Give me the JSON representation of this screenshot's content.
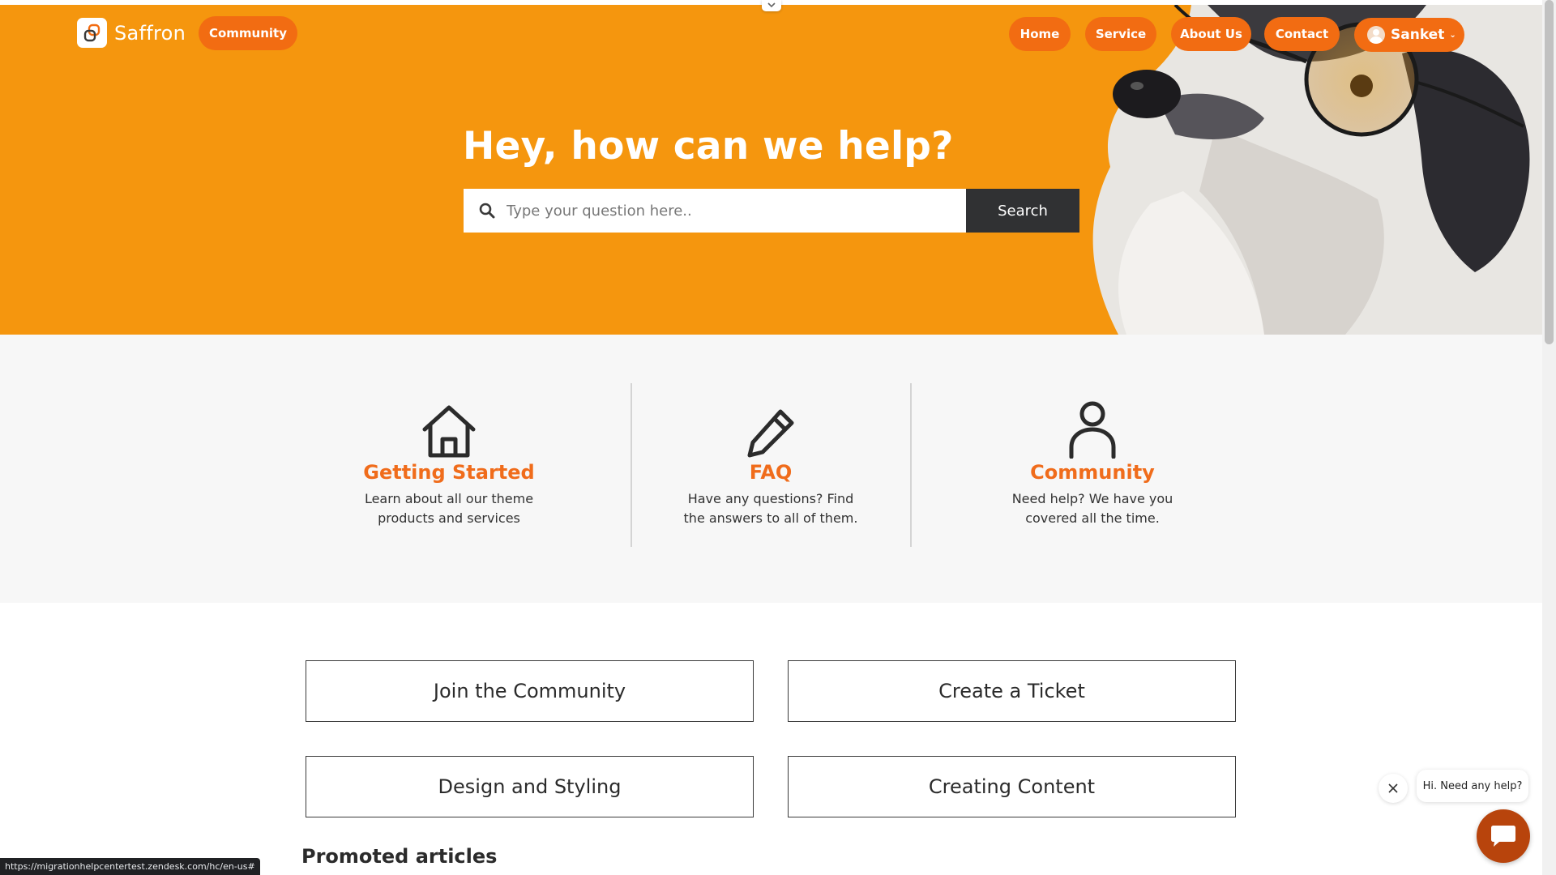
{
  "brand": {
    "name": "Saffron",
    "community_label": "Community"
  },
  "nav": {
    "items": [
      "Home",
      "Service",
      "About Us",
      "Contact"
    ],
    "user_name": "Sanket"
  },
  "hero": {
    "title": "Hey, how can we help?",
    "search_placeholder": "Type your question here..",
    "search_button": "Search"
  },
  "features": [
    {
      "icon": "house-icon",
      "title": "Getting Started",
      "line1": "Learn about all our theme",
      "line2": "products and services"
    },
    {
      "icon": "pencil-icon",
      "title": "FAQ",
      "line1": "Have any questions? Find",
      "line2": "the answers to all of them."
    },
    {
      "icon": "person-icon",
      "title": "Community",
      "line1": "Need help? We have you",
      "line2": "covered all the time."
    }
  ],
  "tiles": [
    "Join the Community",
    "Create a Ticket",
    "Design and Styling",
    "Creating Content"
  ],
  "promoted_heading": "Promoted articles",
  "chat": {
    "bubble_text": "Hi. Need any help?"
  },
  "status_url": "https://migrationhelpcentertest.zendesk.com/hc/en-us#",
  "colors": {
    "hero_bg": "#f5960e",
    "accent": "#f26c12",
    "heading_orange": "#f06c1b",
    "chat_button": "#b8440c",
    "search_button": "#303133"
  }
}
